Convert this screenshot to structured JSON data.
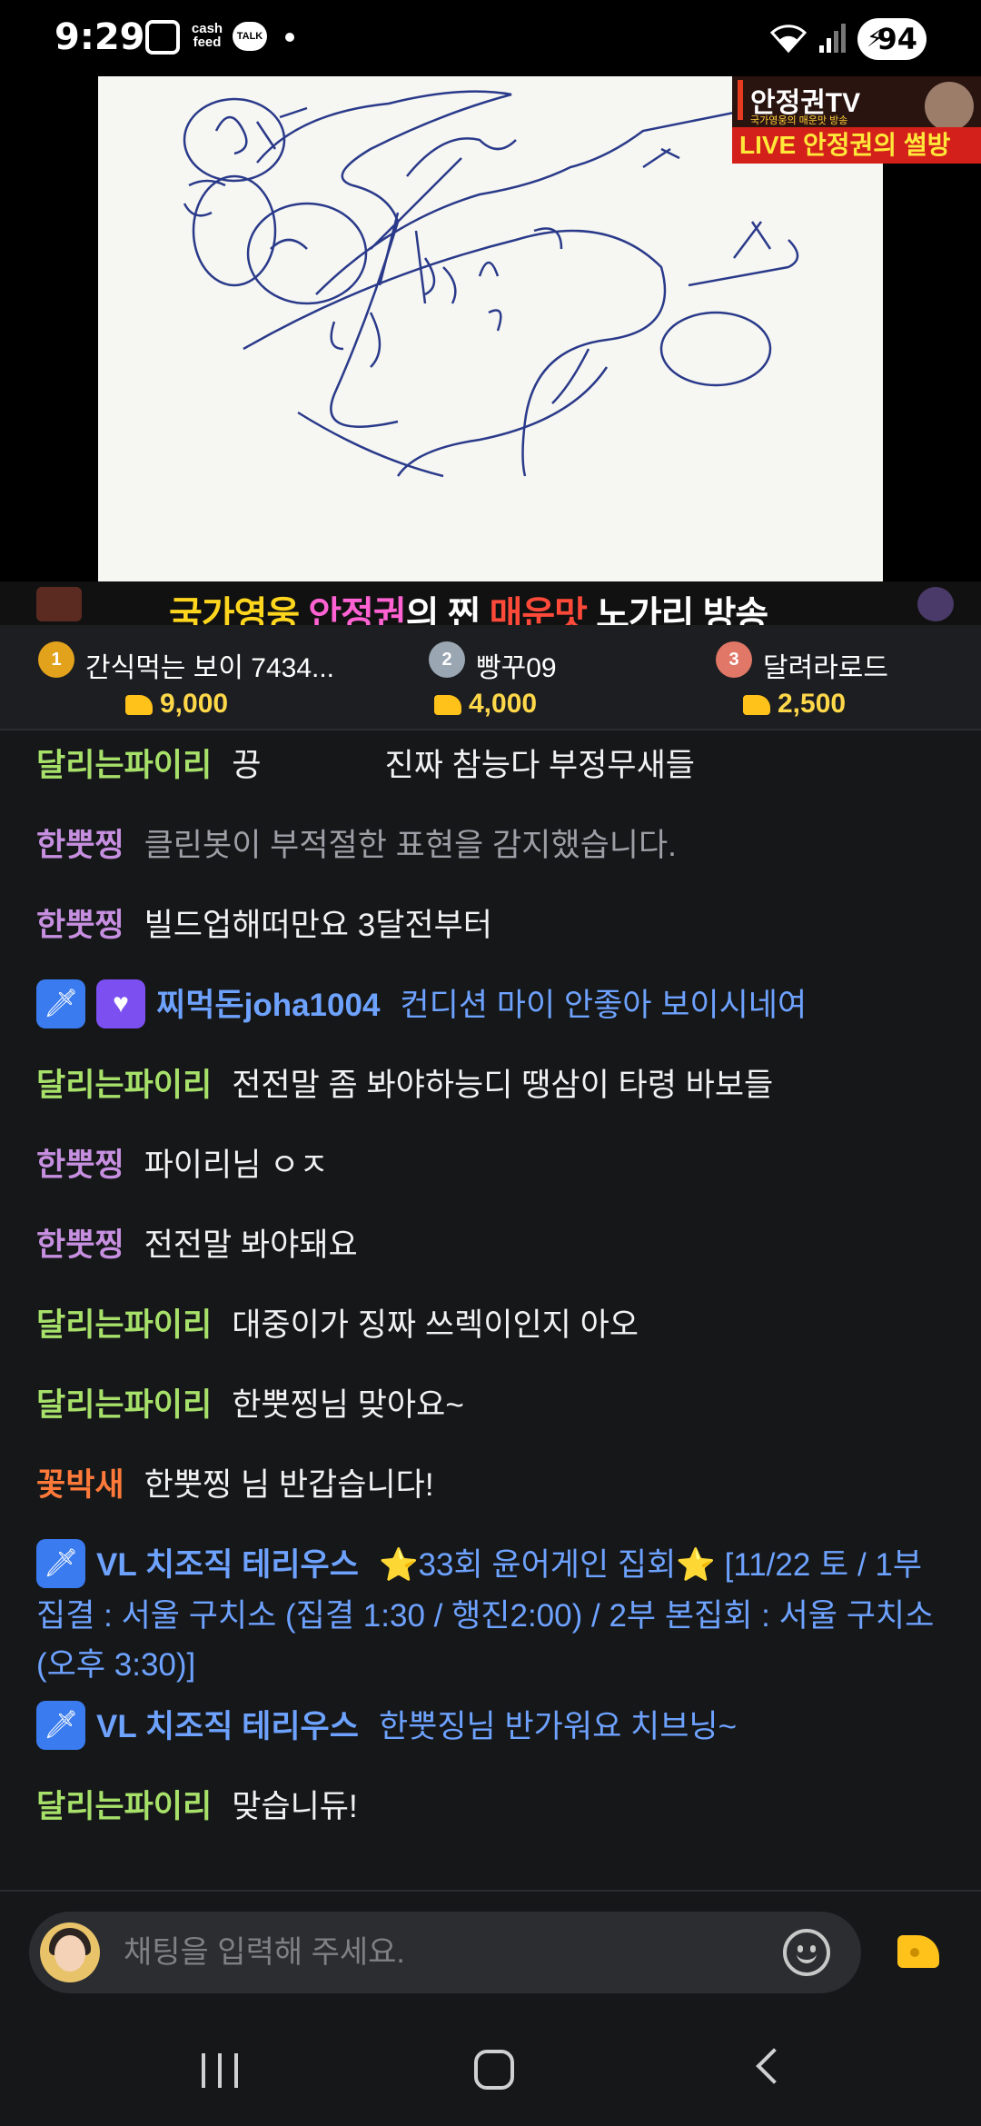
{
  "status_bar": {
    "time": "9:29",
    "cashfeed": "cash feed",
    "talk": "TALK",
    "battery": "94"
  },
  "video": {
    "channel_name": "안정권TV",
    "channel_sub": "국가영웅의 매운맛 방송",
    "live_label": "LIVE 안정권의 썰방",
    "ticker": {
      "part1": "국가영웅 ",
      "part2": "안정권",
      "part3": "의 찐 ",
      "part4": "매운맛",
      "part5": " 노가리 방송"
    }
  },
  "ranking": [
    {
      "rank": "1",
      "name": "간식먹는 보이 7434...",
      "amount": "9,000"
    },
    {
      "rank": "2",
      "name": "빵꾸09",
      "amount": "4,000"
    },
    {
      "rank": "3",
      "name": "달려라로드",
      "amount": "2,500"
    }
  ],
  "chat": [
    {
      "nick": "달리는파이리",
      "text": "끙              진짜 참능다 부정무새들"
    },
    {
      "nick": "한뿟찡",
      "text": "클린봇이 부적절한 표현을 감지했습니다."
    },
    {
      "nick": "한뿟찡",
      "text": "빌드업해떠만요 3달전부터"
    },
    {
      "nick": "찌먹돈joha1004",
      "text": "컨디션 마이 안좋아 보이시네여"
    },
    {
      "nick": "달리는파이리",
      "text": "전전말 좀 봐야하능디 땡삼이 타령 바보들"
    },
    {
      "nick": "한뿟찡",
      "text": "파이리님 ㅇㅈ"
    },
    {
      "nick": "한뿟찡",
      "text": "전전말 봐야돼요"
    },
    {
      "nick": "달리는파이리",
      "text": "대중이가 징짜 쓰렉이인지 아오"
    },
    {
      "nick": "달리는파이리",
      "text": "한뿟찡님 맞아요~"
    },
    {
      "nick": "꽃박새",
      "text": "한뿟찡 님 반갑습니다!"
    },
    {
      "nick": "VL 치조직 테리우스",
      "text": "⭐33회 윤어게인 집회⭐ [11/22 토 / 1부 집결 : 서울 구치소 (집결 1:30 / 행진2:00) / 2부 본집회 : 서울 구치소 (오후 3:30)]"
    },
    {
      "nick": "VL 치조직 테리우스",
      "text": "한뿟징님 반가워요 치브닝~"
    },
    {
      "nick": "달리는파이리",
      "text": "맞습니듀!"
    }
  ],
  "input": {
    "placeholder": "채팅을 입력해 주세요."
  },
  "icons": {
    "sword_badge": "sword-badge-icon",
    "heart_badge": "heart-badge-icon",
    "emoji": "smiley-icon",
    "cheese": "cheese-icon"
  },
  "colors": {
    "nick_green": "#a7e16a",
    "nick_purple": "#c78fe0",
    "nick_orange": "#ff7a3a",
    "nick_blue": "#6ea2ff",
    "cheese": "#ffc21a"
  }
}
